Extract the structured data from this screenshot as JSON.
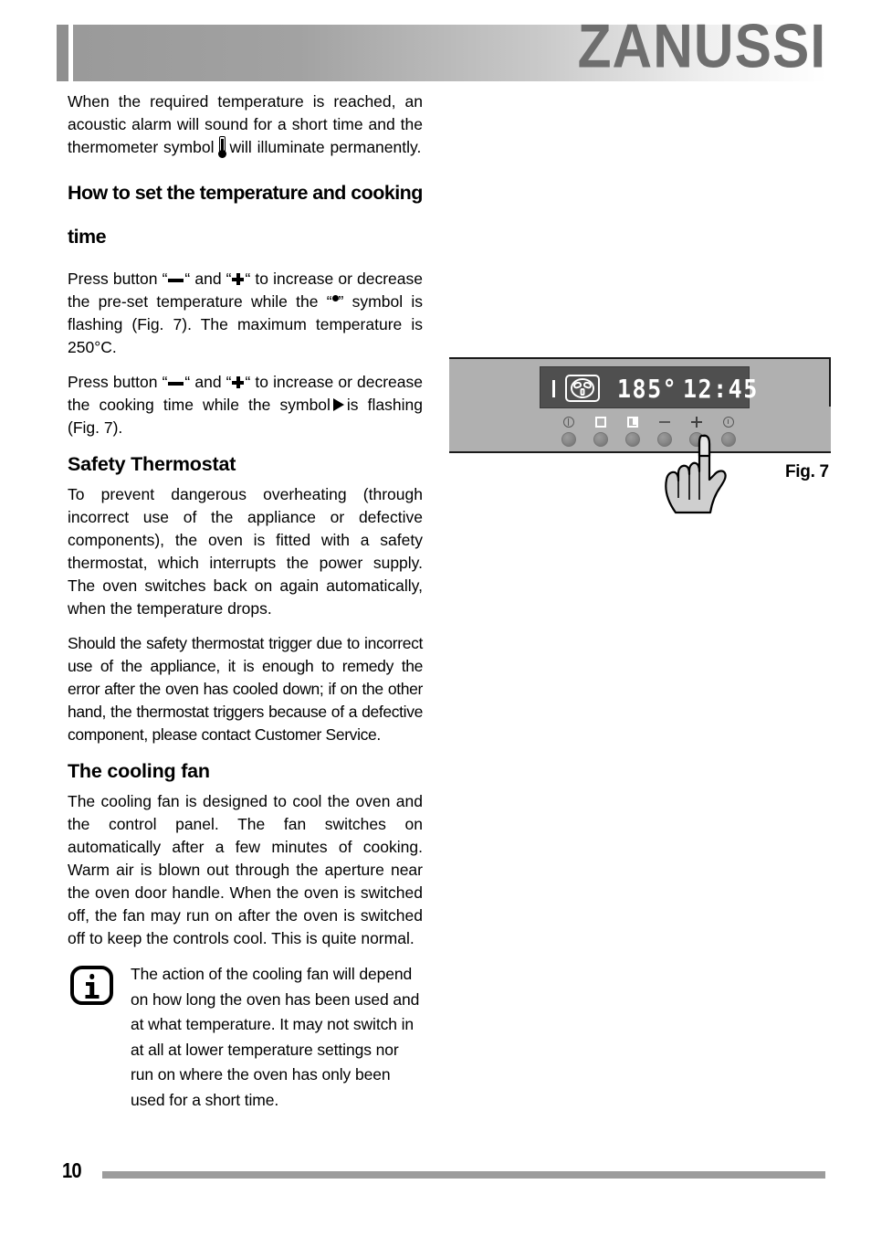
{
  "header": {
    "brand": "ZANUSSI"
  },
  "content": {
    "intro_paragraph": "When the required temperature is reached, an acoustic alarm will sound for a short time and the thermometer symbol",
    "intro_paragraph_tail": "will illuminate permanently.",
    "heading_temp_time": "How to set the temperature and cooking time",
    "para_temp_1a": "Press button “",
    "para_temp_1b": "“ and “",
    "para_temp_1c": "“ to increase or decrease the pre-set temperature while the “",
    "para_temp_1d": "” symbol is flashing (Fig. 7). The maximum temperature is 250°C.",
    "para_time_1a": "Press button “",
    "para_time_1b": "“ and “",
    "para_time_1c": "“ to increase or decrease the cooking time while the symbol",
    "para_time_1d": "is flashing (Fig. 7).",
    "heading_safety": "Safety Thermostat",
    "para_safety_1": "To prevent dangerous overheating (through incorrect use of the appliance or defective components), the oven is fitted with a safety thermostat, which interrupts the power supply. The oven switches back on again automatically, when the temperature drops.",
    "para_safety_2": "Should the safety thermostat trigger due to incorrect use of the appliance, it is enough to remedy the error after the oven has cooled down; if on the other hand, the thermostat triggers because of a defective component, please contact Customer Service.",
    "heading_cooling_fan": "The cooling fan",
    "para_fan_1": "The cooling fan is designed to cool the oven and the control panel. The fan switches on automatically after a few minutes of cooking. Warm air is blown out through the aperture near the oven door handle. When the oven is switched off, the fan may run on after the oven is switched off to keep the controls cool. This is quite normal.",
    "note_text": "The action of the cooling fan will depend on how long the oven has been used and at what temperature. It may not switch in at all at lower temperature settings nor run on where the oven has only been used for a short time."
  },
  "figure": {
    "caption": "Fig. 7",
    "display": {
      "temperature": "185°",
      "time": "12:45"
    },
    "buttons": [
      {
        "icon": "power-icon",
        "label": ""
      },
      {
        "icon": "oven-square-icon",
        "label": ""
      },
      {
        "icon": "oven-square-inner-icon",
        "label": ""
      },
      {
        "icon": "minus-icon",
        "label": ""
      },
      {
        "icon": "plus-icon",
        "label": ""
      },
      {
        "icon": "timer-clock-icon",
        "label": ""
      }
    ]
  },
  "footer": {
    "page_number": "10"
  },
  "colors": {
    "panel_gray": "#b0b0b0",
    "lcd_dark": "#4f4f4f",
    "brand_gray": "#6e6e6e",
    "rule_gray": "#9c9c9c"
  }
}
